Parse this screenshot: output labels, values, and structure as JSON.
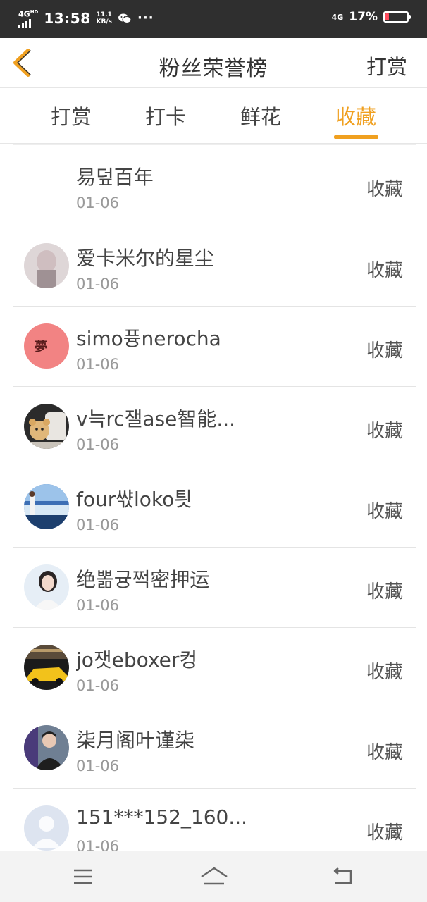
{
  "status_bar": {
    "network_left": "4G",
    "network_left_sup": "HD",
    "time": "13:58",
    "speed_value": "11.1",
    "speed_unit": "KB/s",
    "more": "···",
    "network_right": "4G",
    "battery_pct": "17%",
    "battery_level": 0.17,
    "battery_color": "#ff4d5e"
  },
  "header": {
    "title": "粉丝荣誉榜",
    "action": "打赏",
    "back_icon": "chevron-left-icon",
    "accent": "#f0a020"
  },
  "tabs": [
    {
      "label": "打赏",
      "active": false
    },
    {
      "label": "打卡",
      "active": false
    },
    {
      "label": "鲜花",
      "active": false
    },
    {
      "label": "收藏",
      "active": true
    }
  ],
  "list": [
    {
      "name": "易덮百年",
      "date": "01-06",
      "action": "收藏",
      "avatar": "none"
    },
    {
      "name": "爱卡米尔的星尘",
      "date": "01-06",
      "action": "收藏",
      "avatar": "photo-pink-figure"
    },
    {
      "name": "simo퓽nerocha",
      "date": "01-06",
      "action": "收藏",
      "avatar": "red-circle-text",
      "avatar_text": "夢"
    },
    {
      "name": "v늑rc잴ase智能...",
      "date": "01-06",
      "action": "收藏",
      "avatar": "photo-teddy-bear"
    },
    {
      "name": "four쌳loko틧",
      "date": "01-06",
      "action": "收藏",
      "avatar": "photo-blue-landscape"
    },
    {
      "name": "绝뽊귱쩍密押运",
      "date": "01-06",
      "action": "收藏",
      "avatar": "photo-woman"
    },
    {
      "name": "jo잿eboxer컹",
      "date": "01-06",
      "action": "收藏",
      "avatar": "photo-yellow-car"
    },
    {
      "name": "柒月阁叶谨柒",
      "date": "01-06",
      "action": "收藏",
      "avatar": "photo-man"
    },
    {
      "name": "151***152_160...",
      "date": "01-06",
      "action": "收藏",
      "avatar": "default-user-icon"
    }
  ],
  "navbar": {
    "menu_icon": "menu-icon",
    "home_icon": "home-icon",
    "back_icon": "back-arrow-icon"
  }
}
